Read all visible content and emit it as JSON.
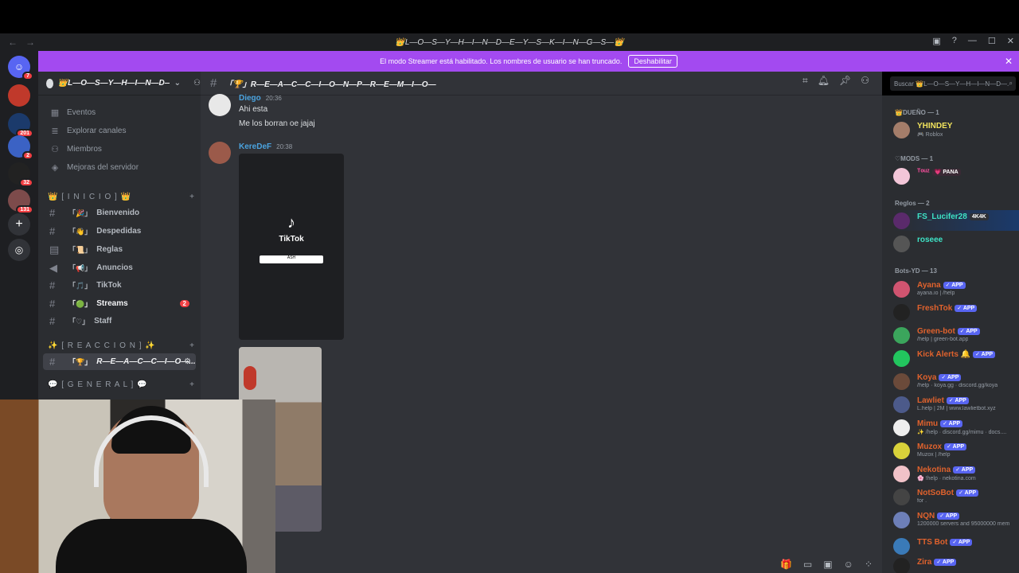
{
  "window": {
    "title": "👑L—O—S—Y—H—I—N—D—E—Y—S—K—I—N—G—S—👑"
  },
  "banner": {
    "text": "El modo Streamer está habilitado. Los nombres de usuario se han truncado.",
    "button": "Deshabilitar"
  },
  "guilds": [
    {
      "badge": "7"
    },
    {
      "badge": ""
    },
    {
      "badge": "201"
    },
    {
      "badge": "2"
    },
    {
      "badge": "32"
    },
    {
      "badge": "131"
    }
  ],
  "server": {
    "name": "👑L—O—S—Y—H—I—N—D—E—Y—S—K—I—N—G—S—👑"
  },
  "sidebar": {
    "top_items": [
      "Eventos",
      "Explorar canales",
      "Miembros",
      "Mejoras del servidor"
    ],
    "categories": [
      "👑 [ I N I C I O ] 👑",
      "✨ [ R E A C C I O N ] ✨",
      "💬 [ G E N E R A L ] 💬"
    ],
    "channels": [
      {
        "emoji": "「🎉」",
        "name": "Bienvenido"
      },
      {
        "emoji": "「👋」",
        "name": "Despedidas"
      },
      {
        "emoji": "「📜」",
        "name": "Reglas"
      },
      {
        "emoji": "「📢」",
        "name": "Anuncios"
      },
      {
        "emoji": "「🎵」",
        "name": "TikTok"
      },
      {
        "emoji": "「🟢」",
        "name": "Streams",
        "badge": "2"
      },
      {
        "emoji": "「♡」",
        "name": "Staff"
      }
    ],
    "active_channel": {
      "emoji": "「🏆」",
      "name": "R—E—A—C—C—I—O—..."
    }
  },
  "channel": {
    "title": "「🏆」R—E—A—C—C—I—O—N—P—R—E—M—I—O—"
  },
  "search": {
    "placeholder": "Buscar 👑L—O—S—Y—H—I—N—D—..."
  },
  "messages": [
    {
      "author": "Diego",
      "time": "20:36",
      "lines": [
        "Ahi esta",
        "Me los borran oe jajaj"
      ]
    },
    {
      "author": "KereDeF",
      "time": "20:38",
      "embed": {
        "logo": "TikTok",
        "button": "ASH"
      }
    }
  ],
  "members": {
    "roles": [
      "👑DUEÑO — 1",
      "♡MODS — 1",
      "Reglos — 2",
      "Bots-YD — 13"
    ],
    "list": [
      {
        "name": "YHINDEY",
        "status": "🎮 Roblox",
        "color": "#f1e35d",
        "app": false
      },
      {
        "name": "ᵀᵒᵘᶻ",
        "status": "",
        "tag": "💗 PANA",
        "color": "#ff4fa0",
        "app": false
      },
      {
        "name": "FS_Lucifer28",
        "status": "",
        "tag": "4K4K",
        "color": "#3ee3c6",
        "app": false
      },
      {
        "name": "roseee",
        "status": "",
        "color": "#3ee3c6",
        "app": false
      },
      {
        "name": "Ayana",
        "status": "ayana.io | /help",
        "color": "#e0622d",
        "app": true
      },
      {
        "name": "FreshTok",
        "status": "",
        "color": "#e0622d",
        "app": true
      },
      {
        "name": "Green-bot",
        "status": "/help | green-bot.app",
        "color": "#e0622d",
        "app": true
      },
      {
        "name": "Kick Alerts 🔔",
        "status": "",
        "color": "#e0622d",
        "app": true
      },
      {
        "name": "Koya",
        "status": "/help · koya.gg · discord.gg/koya",
        "color": "#e0622d",
        "app": true
      },
      {
        "name": "Lawliet",
        "status": "L.help | 2M | www.lawlietbot.xyz",
        "color": "#e0622d",
        "app": true
      },
      {
        "name": "Mimu",
        "status": "✨ /help · discord.gg/mimu · docs....",
        "color": "#e0622d",
        "app": true
      },
      {
        "name": "Muzox",
        "status": "Muzox | /help",
        "color": "#e0622d",
        "app": true
      },
      {
        "name": "Nekotina",
        "status": "🌸 !help · nekotina.com",
        "color": "#e0622d",
        "app": true
      },
      {
        "name": "NotSoBot",
        "status": "for .",
        "color": "#e0622d",
        "app": true
      },
      {
        "name": "NQN",
        "status": "1200000 servers and 95000000 mem",
        "color": "#e0622d",
        "app": true
      },
      {
        "name": "TTS Bot",
        "status": "",
        "color": "#e0622d",
        "app": true
      },
      {
        "name": "Zira",
        "status": "",
        "color": "#e0622d",
        "app": true
      }
    ],
    "app_label": "✓ APP"
  },
  "colors": {
    "accent": "#a34af0",
    "sidebar": "#2b2d31",
    "main": "#313338"
  }
}
